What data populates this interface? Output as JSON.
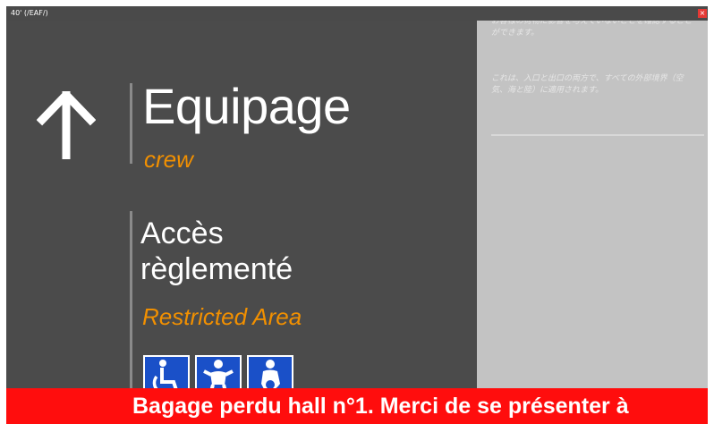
{
  "window": {
    "title": "40' (/EAF/)",
    "close_glyph": "×"
  },
  "sign": {
    "direction_icon": "arrow-up-icon",
    "heading_fr": "Equipage",
    "heading_en": "crew",
    "access_fr_line1": "Accès",
    "access_fr_line2": "règlementé",
    "access_en": "Restricted Area",
    "pictograms": [
      "wheelchair-icon",
      "baby-icon",
      "pregnant-woman-icon"
    ],
    "colors": {
      "panel": "#4b4b4b",
      "accent": "#f29000",
      "picto": "#1a50c8"
    }
  },
  "info_panel": {
    "paragraph1": "お客様の荷物に影響を与えていないことを確認することができます。",
    "paragraph2": "これは、入口と出口の両方で、すべての外部境界（空気、海と陸）に適用されます。"
  },
  "ticker": {
    "text": "Bagage perdu hall n°1. Merci de se présenter à",
    "color": "#ff0d0d"
  }
}
